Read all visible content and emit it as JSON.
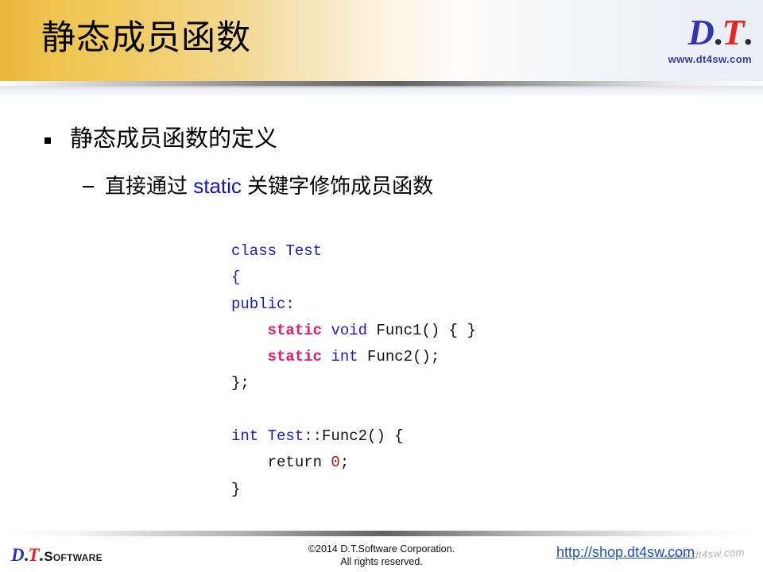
{
  "slide": {
    "title": "静态成员函数",
    "header_logo": {
      "d": "D",
      "dot1": ".",
      "t": "T",
      "dot2": ".",
      "url": "www.dt4sw.com"
    },
    "bullets": {
      "level1": "静态成员函数的定义",
      "level2_before": "直接通过 ",
      "level2_keyword": "static",
      "level2_after": " 关键字修饰成员函数"
    },
    "code": {
      "language": "cpp",
      "lines": [
        [
          {
            "t": "class Test",
            "c": "blue"
          }
        ],
        [
          {
            "t": "{",
            "c": "blue"
          }
        ],
        [
          {
            "t": "public:",
            "c": "blue"
          }
        ],
        [
          {
            "t": "    ",
            "c": "black"
          },
          {
            "t": "static",
            "c": "static"
          },
          {
            "t": " ",
            "c": "black"
          },
          {
            "t": "void",
            "c": "blue"
          },
          {
            "t": " Func1() { }",
            "c": "black"
          }
        ],
        [
          {
            "t": "    ",
            "c": "black"
          },
          {
            "t": "static",
            "c": "static"
          },
          {
            "t": " ",
            "c": "black"
          },
          {
            "t": "int",
            "c": "blue"
          },
          {
            "t": " Func2();",
            "c": "black"
          }
        ],
        [
          {
            "t": "};",
            "c": "black"
          }
        ],
        [
          {
            "t": " ",
            "c": "black"
          }
        ],
        [
          {
            "t": "int Test::",
            "c": "blue"
          },
          {
            "t": "Func2() {",
            "c": "black"
          }
        ],
        [
          {
            "t": "    return ",
            "c": "black"
          },
          {
            "t": "0",
            "c": "red"
          },
          {
            "t": ";",
            "c": "black"
          }
        ],
        [
          {
            "t": "}",
            "c": "black"
          }
        ]
      ]
    },
    "footer": {
      "logo": {
        "d": "D",
        "dot1": ".",
        "t": "T",
        "dot2": ".",
        "software": "Software"
      },
      "copyright_line1": "©2014 D.T.Software Corporation.",
      "copyright_line2": "All rights reserved.",
      "shop_link": "http://shop.dt4sw.com",
      "watermark": "www.dt4sw.com"
    },
    "colors": {
      "header_gold": "#efc44e",
      "logo_blue": "#2e35b5",
      "logo_red": "#e8221f",
      "keyword_blue": "#1a1acd",
      "static_crimson": "#e61a6b",
      "literal_red": "#a01818",
      "link_blue": "#1b4fc0"
    }
  }
}
